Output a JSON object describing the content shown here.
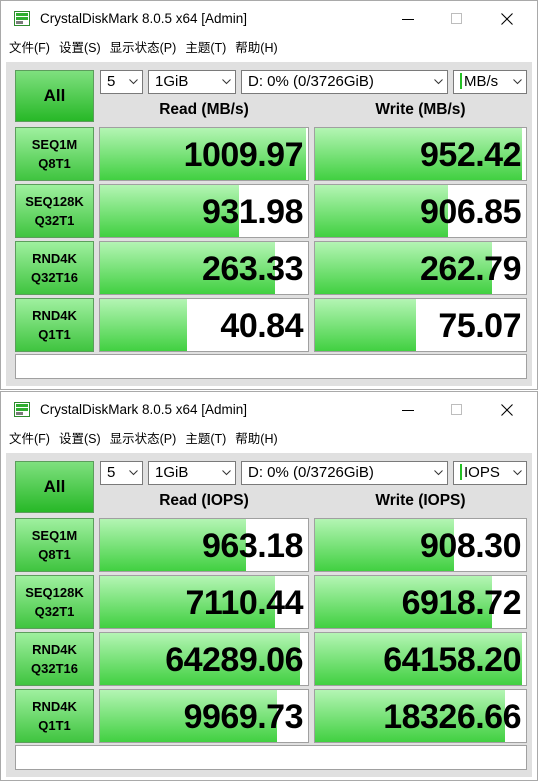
{
  "windows": [
    {
      "title": "CrystalDiskMark 8.0.5 x64 [Admin]",
      "menu": [
        "文件(F)",
        "设置(S)",
        "显示状态(P)",
        "主题(T)",
        "帮助(H)"
      ],
      "all_label": "All",
      "count": "5",
      "size": "1GiB",
      "drive": "D: 0% (0/3726GiB)",
      "unit": "MB/s",
      "read_header": "Read (MB/s)",
      "write_header": "Write (MB/s)",
      "comment": "",
      "rows": [
        {
          "line1": "SEQ1M",
          "line2": "Q8T1",
          "read": "1009.97",
          "write": "952.42",
          "read_fill": 0.99,
          "write_fill": 0.98
        },
        {
          "line1": "SEQ128K",
          "line2": "Q32T1",
          "read": "931.98",
          "write": "906.85",
          "read_fill": 0.67,
          "write_fill": 0.63
        },
        {
          "line1": "RND4K",
          "line2": "Q32T16",
          "read": "263.33",
          "write": "262.79",
          "read_fill": 0.84,
          "write_fill": 0.84
        },
        {
          "line1": "RND4K",
          "line2": "Q1T1",
          "read": "40.84",
          "write": "75.07",
          "read_fill": 0.42,
          "write_fill": 0.48
        }
      ]
    },
    {
      "title": "CrystalDiskMark 8.0.5 x64 [Admin]",
      "menu": [
        "文件(F)",
        "设置(S)",
        "显示状态(P)",
        "主题(T)",
        "帮助(H)"
      ],
      "all_label": "All",
      "count": "5",
      "size": "1GiB",
      "drive": "D: 0% (0/3726GiB)",
      "unit": "IOPS",
      "read_header": "Read (IOPS)",
      "write_header": "Write (IOPS)",
      "comment": "",
      "rows": [
        {
          "line1": "SEQ1M",
          "line2": "Q8T1",
          "read": "963.18",
          "write": "908.30",
          "read_fill": 0.7,
          "write_fill": 0.66
        },
        {
          "line1": "SEQ128K",
          "line2": "Q32T1",
          "read": "7110.44",
          "write": "6918.72",
          "read_fill": 0.84,
          "write_fill": 0.84
        },
        {
          "line1": "RND4K",
          "line2": "Q32T16",
          "read": "64289.06",
          "write": "64158.20",
          "read_fill": 0.96,
          "write_fill": 0.98
        },
        {
          "line1": "RND4K",
          "line2": "Q1T1",
          "read": "9969.73",
          "write": "18326.66",
          "read_fill": 0.85,
          "write_fill": 0.9
        }
      ]
    }
  ],
  "icons": {
    "app": "crystaldiskmark-app-icon",
    "minimize": "minimize-icon",
    "maximize": "maximize-icon",
    "close": "close-icon",
    "dropdown": "chevron-down-icon"
  },
  "colors": {
    "button_green": "#27b827",
    "bar_green": "#41d041",
    "panel_bg": "#e0e0e0"
  }
}
